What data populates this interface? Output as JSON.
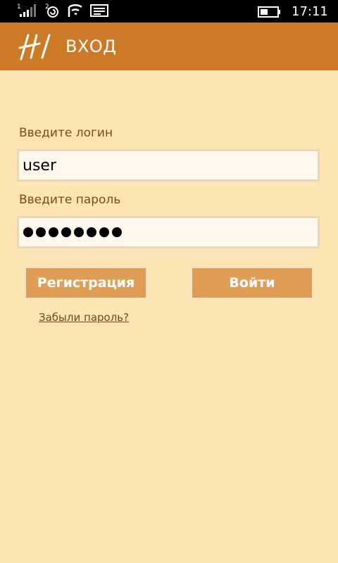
{
  "status_bar": {
    "time": "17:11",
    "sim1_label": "1",
    "sim2_label": "2",
    "icons": [
      "signal-strength-icon",
      "signal-strength-icon",
      "wifi-icon",
      "message-icon",
      "battery-icon"
    ]
  },
  "header": {
    "title": "ВХОД",
    "background_color": "#cd7a26"
  },
  "form": {
    "login_label": "Введите логин",
    "login_value": "user",
    "password_label": "Введите пароль",
    "password_dot_count": 8
  },
  "buttons": {
    "register_label": "Регистрация",
    "login_label": "Войти"
  },
  "links": {
    "forgot_password": "Забыли пароль?"
  },
  "colors": {
    "background": "#fde4b3",
    "button": "#e09d55",
    "label_text": "#7a4a1e"
  }
}
